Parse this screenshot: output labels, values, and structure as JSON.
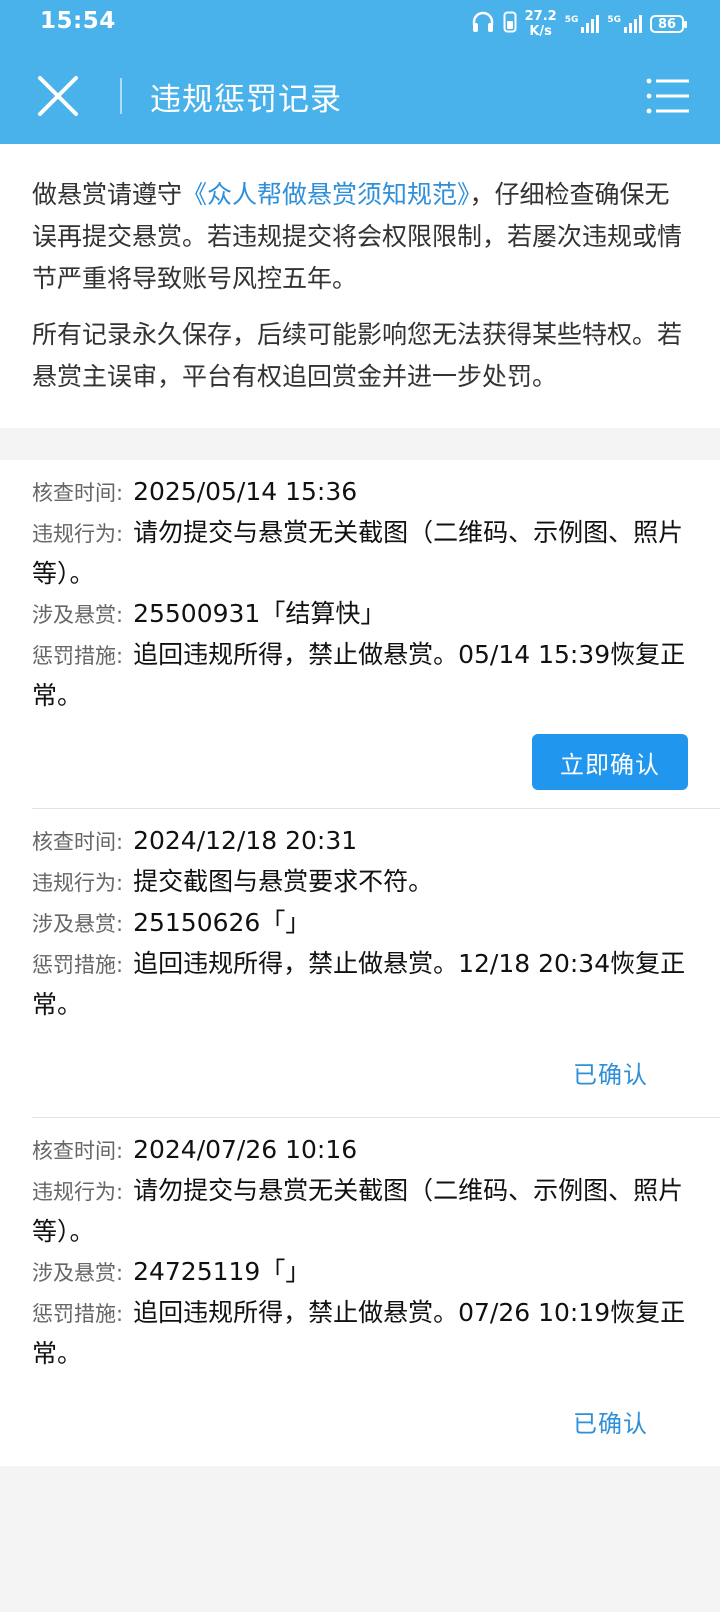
{
  "status_bar": {
    "time": "15:54",
    "net_speed_value": "27.2",
    "net_speed_unit": "K/s",
    "signal1_label": "5G",
    "signal2_label": "5G",
    "battery": "86"
  },
  "header": {
    "title": "违规惩罚记录"
  },
  "notice": {
    "p1_prefix": "做悬赏请遵守",
    "p1_link": "《众人帮做悬赏须知规范》",
    "p1_suffix": "，仔细检查确保无误再提交悬赏。若违规提交将会权限限制，若屡次违规或情节严重将导致账号风控五年。",
    "p2": "所有记录永久保存，后续可能影响您无法获得某些特权。若悬赏主误审，平台有权追回赏金并进一步处罚。"
  },
  "labels": {
    "check_time": "核查时间:",
    "violation": "违规行为:",
    "reward": "涉及悬赏:",
    "penalty": "惩罚措施:"
  },
  "records": [
    {
      "check_time": "2025/05/14 15:36",
      "violation": "请勿提交与悬赏无关截图（二维码、示例图、照片等）。",
      "reward": "25500931「结算快」",
      "penalty": "追回违规所得，禁止做悬赏。05/14 15:39恢复正常。",
      "action": "立即确认"
    },
    {
      "check_time": "2024/12/18 20:31",
      "violation": "提交截图与悬赏要求不符。",
      "reward": "25150626「」",
      "penalty": "追回违规所得，禁止做悬赏。12/18 20:34恢复正常。",
      "action": "已确认"
    },
    {
      "check_time": "2024/07/26 10:16",
      "violation": "请勿提交与悬赏无关截图（二维码、示例图、照片等）。",
      "reward": "24725119「」",
      "penalty": "追回违规所得，禁止做悬赏。07/26 10:19恢复正常。",
      "action": "已确认"
    }
  ],
  "colors": {
    "header_bg": "#4ab2ea",
    "link": "#2f8fd8",
    "confirm_button": "#2196ef"
  }
}
